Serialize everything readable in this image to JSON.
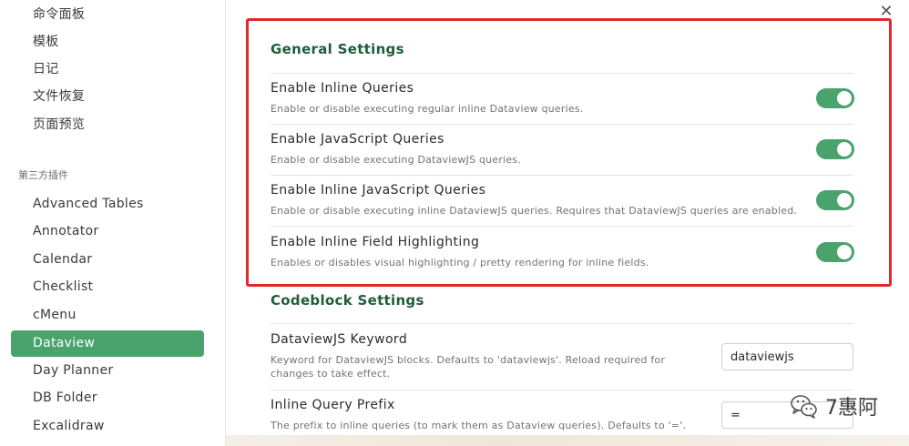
{
  "sidebar": {
    "core_items": [
      {
        "label": "命令面板"
      },
      {
        "label": "模板"
      },
      {
        "label": "日记"
      },
      {
        "label": "文件恢复"
      },
      {
        "label": "页面预览"
      }
    ],
    "plugins_section_label": "第三方插件",
    "plugin_items": [
      {
        "label": "Advanced Tables"
      },
      {
        "label": "Annotator"
      },
      {
        "label": "Calendar"
      },
      {
        "label": "Checklist"
      },
      {
        "label": "cMenu"
      },
      {
        "label": "Dataview",
        "active": true
      },
      {
        "label": "Day Planner"
      },
      {
        "label": "DB Folder"
      },
      {
        "label": "Excalidraw"
      }
    ]
  },
  "main": {
    "close_glyph": "✕",
    "general": {
      "title": "General Settings",
      "settings": [
        {
          "name": "Enable Inline Queries",
          "desc": "Enable or disable executing regular inline Dataview queries.",
          "enabled": true
        },
        {
          "name": "Enable JavaScript Queries",
          "desc": "Enable or disable executing DataviewJS queries.",
          "enabled": true
        },
        {
          "name": "Enable Inline JavaScript Queries",
          "desc": "Enable or disable executing inline DataviewJS queries. Requires that DataviewJS queries are enabled.",
          "enabled": true
        },
        {
          "name": "Enable Inline Field Highlighting",
          "desc": "Enables or disables visual highlighting / pretty rendering for inline fields.",
          "enabled": true
        }
      ]
    },
    "codeblock": {
      "title": "Codeblock Settings",
      "settings": [
        {
          "name": "DataviewJS Keyword",
          "desc_line1": "Keyword for DataviewJS blocks. Defaults to 'dataviewjs'. Reload required for",
          "desc_line2": "changes to take effect.",
          "value": "dataviewjs"
        },
        {
          "name": "Inline Query Prefix",
          "desc_line1": "The prefix to inline queries (to mark them as Dataview queries). Defaults to '='.",
          "value": "="
        }
      ]
    }
  },
  "colors": {
    "accent_green": "#4aa36c",
    "title_green": "#1f5c3b",
    "highlight_red": "#e02a2a"
  },
  "watermark": {
    "text": "7惠阿",
    "icon": "wechat-logo-icon"
  }
}
